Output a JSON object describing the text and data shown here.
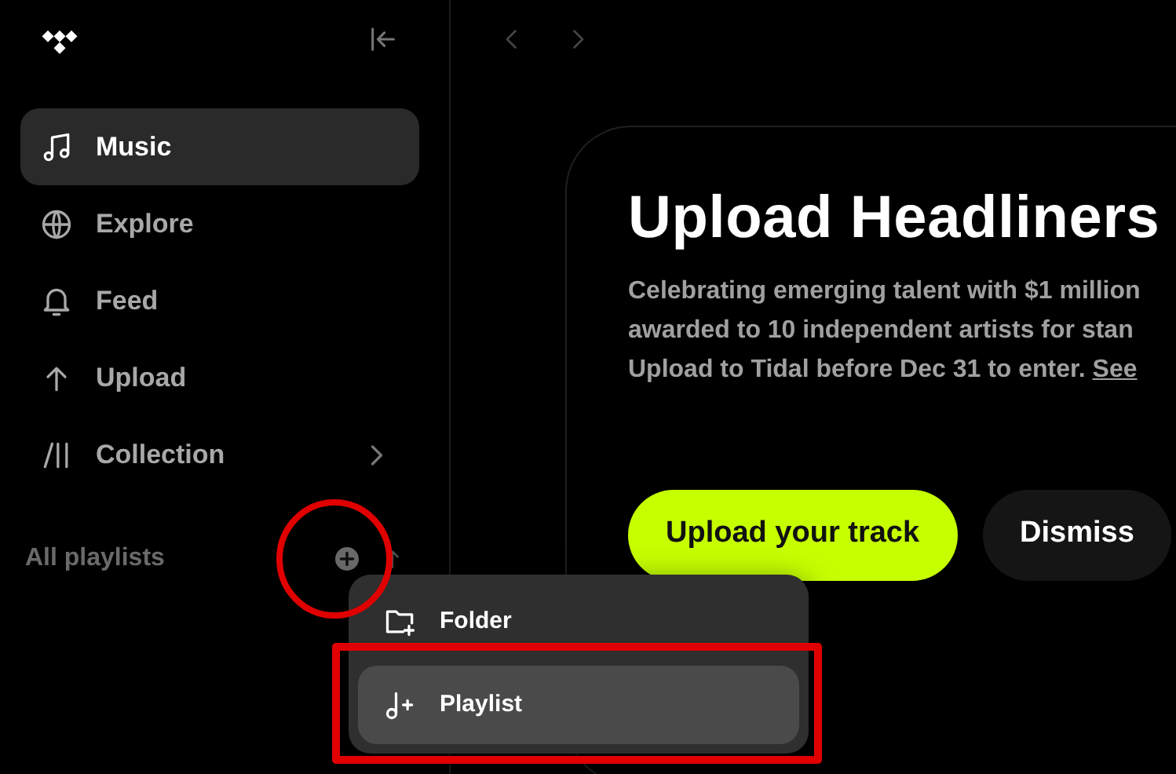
{
  "sidebar": {
    "items": [
      {
        "label": "Music",
        "selected": true,
        "has_submenu": false
      },
      {
        "label": "Explore",
        "selected": false,
        "has_submenu": false
      },
      {
        "label": "Feed",
        "selected": false,
        "has_submenu": false
      },
      {
        "label": "Upload",
        "selected": false,
        "has_submenu": false
      },
      {
        "label": "Collection",
        "selected": false,
        "has_submenu": true
      }
    ],
    "playlists_label": "All playlists"
  },
  "banner": {
    "title": "Upload Headliners",
    "description_lines": [
      "Celebrating emerging talent with $1 million",
      "awarded to 10 independent artists for stan",
      "Upload to Tidal before Dec 31 to enter."
    ],
    "link": "See",
    "buttons": [
      {
        "label": "Upload your track",
        "kind": "primary"
      },
      {
        "label": "Dismiss",
        "kind": "secondary"
      }
    ]
  },
  "new_menu": {
    "items": [
      {
        "label": "Folder",
        "selected": false
      },
      {
        "label": "Playlist",
        "selected": true
      }
    ]
  }
}
